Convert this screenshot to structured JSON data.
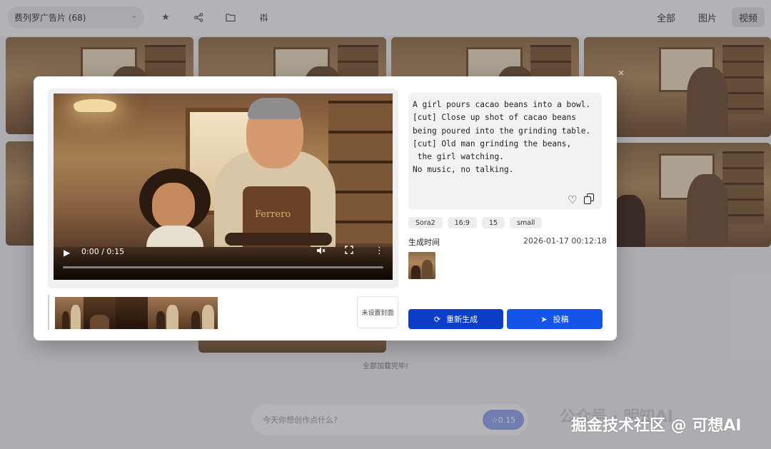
{
  "header": {
    "album_select": "费列罗广告片 (68)",
    "filters": [
      "全部",
      "图片",
      "视频"
    ],
    "active_filter": "视频"
  },
  "gallery": {
    "loaded_text": "全部加载完毕!"
  },
  "prompt_bar": {
    "placeholder": "今天你想创作点什么?",
    "credit_label": "☆0.15"
  },
  "watermark": {
    "text": "掘金技术社区 @ 可想AI",
    "bg_text": "公众号 · 明知AI"
  },
  "modal": {
    "video": {
      "time": "0:00 / 0:15",
      "progress": 0,
      "apron_text": "Ferrero"
    },
    "cover_button": "未设置封面",
    "prompt": "A girl pours cacao beans into a bowl.\n[cut] Close up shot of cacao beans\nbeing poured into the grinding table.\n[cut] Old man grinding the beans,\n the girl watching.\nNo music, no talking.",
    "tags": [
      "Sora2",
      "16:9",
      "15",
      "small"
    ],
    "gen_label": "生成时间",
    "gen_time": "2026-01-17 00:12:18",
    "regenerate_label": "重新生成",
    "submit_label": "投稿"
  },
  "colors": {
    "primary": "#1554e8",
    "primary_dark": "#0c3ec7"
  }
}
